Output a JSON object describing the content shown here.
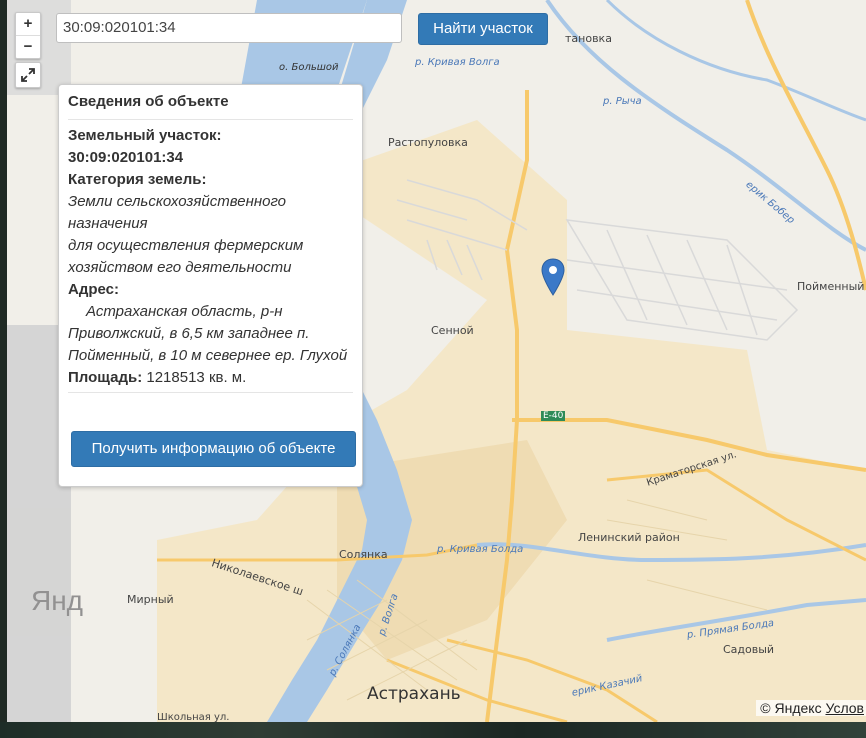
{
  "search": {
    "value": "30:09:020101:34",
    "button_label": "Найти участок"
  },
  "controls": {
    "zoom_in": "+",
    "zoom_out": "−"
  },
  "panel": {
    "title": "Сведения об объекте",
    "parcel_label": "Земельный участок:",
    "parcel_number": "30:09:020101:34",
    "category_label": "Категория земель:",
    "category_line1": "Земли сельскохозяйственного назначения",
    "category_line2": "для осуществления фермерским хозяйством его деятельности",
    "address_label": "Адрес:",
    "address_value": "Астраханская область, р-н Приволжский, в 6,5 км западнее п. Пойменный, в 10 м севернее ер. Глухой",
    "area_label": "Площадь:",
    "area_value": "1218513 кв. м.",
    "button_label": "Получить информацию об объекте"
  },
  "map_labels": {
    "rastopulovka": "Растопуловка",
    "sennoy": "Сенной",
    "poymenny": "Пойменный",
    "solyanka": "Солянка",
    "mirny": "Мирный",
    "astrakhan": "Астрахань",
    "leninsky": "Ленинский район",
    "sadovy": "Садовый",
    "nikolaevskoe": "Николаевское ш",
    "kramatorskaya": "Краматорская ул.",
    "shkolnaya": "Школьная ул.",
    "kozachiy": "ерик Казачий",
    "bolshoy": "о. Большой",
    "krivaya_volga": "р. Кривая Волга",
    "rycha": "р. Рыча",
    "bober": "ерик Бобер",
    "krivaya_bolda": "р. Кривая Болда",
    "pryamaya_bolda": "р. Прямая Болда",
    "volga": "р. Волга",
    "solyanka_river": "р. Солянка",
    "e40": "E-40",
    "tanovka": "тановка",
    "ghost_ya": "Янд",
    "ghost_ya2": "Янд"
  },
  "attribution": {
    "prefix": "© Яндекс",
    "link": "Услов"
  },
  "colors": {
    "accent": "#337ab7",
    "marker": "#3b79c8",
    "water": "#a9c7e6",
    "road": "#f7c96b",
    "urban": "#f2e2bd"
  }
}
